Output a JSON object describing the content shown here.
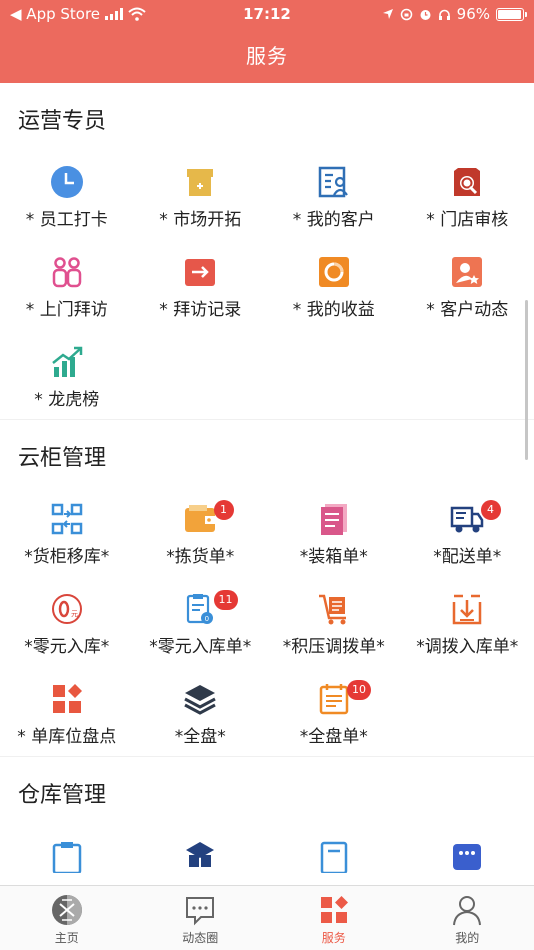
{
  "status_bar": {
    "back_app": "◀ App Store",
    "time": "17:12",
    "battery": "96%",
    "battery_level": 0.96
  },
  "header": {
    "title": "服务"
  },
  "sections": [
    {
      "title": "运营专员",
      "items": [
        {
          "label": "* 员工打卡",
          "icon": "clock-icon",
          "color": "#4a90e2"
        },
        {
          "label": "* 市场开拓",
          "icon": "shop-icon",
          "color": "#e6b84a"
        },
        {
          "label": "* 我的客户",
          "icon": "customer-card-icon",
          "color": "#2f6fb5"
        },
        {
          "label": "* 门店审核",
          "icon": "store-search-icon",
          "color": "#c0392b"
        },
        {
          "label": "* 上门拜访",
          "icon": "visit-people-icon",
          "color": "#e0508f"
        },
        {
          "label": "* 拜访记录",
          "icon": "visit-record-icon",
          "color": "#e6574a"
        },
        {
          "label": "* 我的收益",
          "icon": "earnings-icon",
          "color": "#f08a24"
        },
        {
          "label": "* 客户动态",
          "icon": "customer-activity-icon",
          "color": "#ee7452"
        },
        {
          "label": "* 龙虎榜",
          "icon": "ranking-chart-icon",
          "color": "#2eaa8f"
        }
      ]
    },
    {
      "title": "云柜管理",
      "items": [
        {
          "label": "*货柜移库*",
          "icon": "container-transfer-icon",
          "color": "#3a8fd8"
        },
        {
          "label": "*拣货单*",
          "icon": "picking-wallet-icon",
          "color": "#f2a33a",
          "badge": "1"
        },
        {
          "label": "*装箱单*",
          "icon": "packing-list-icon",
          "color": "#d9578a"
        },
        {
          "label": "*配送单*",
          "icon": "delivery-truck-icon",
          "color": "#23417f",
          "badge": "4"
        },
        {
          "label": "*零元入库*",
          "icon": "zero-yuan-icon",
          "color": "#d9463b"
        },
        {
          "label": "*零元入库单*",
          "icon": "zero-yuan-list-icon",
          "color": "#3a8fd8",
          "badge": "11"
        },
        {
          "label": "*积压调拨单*",
          "icon": "cart-transfer-icon",
          "color": "#e8692f"
        },
        {
          "label": "*调拨入库单*",
          "icon": "transfer-inbound-icon",
          "color": "#e8692f"
        },
        {
          "label": "* 单库位盘点",
          "icon": "slot-inventory-icon",
          "color": "#e8573f"
        },
        {
          "label": "*全盘*",
          "icon": "layers-icon",
          "color": "#2f3a4a"
        },
        {
          "label": "*全盘单*",
          "icon": "calendar-list-icon",
          "color": "#f08a24",
          "badge": "10"
        }
      ]
    },
    {
      "title": "仓库管理",
      "items": [
        {
          "label": "",
          "icon": "warehouse-clipboard-icon",
          "color": "#3a8fd8"
        },
        {
          "label": "",
          "icon": "warehouse-boxes-icon",
          "color": "#23417f"
        },
        {
          "label": "",
          "icon": "warehouse-doc-icon",
          "color": "#3a8fd8"
        },
        {
          "label": "",
          "icon": "warehouse-chat-icon",
          "color": "#3a5fcd"
        }
      ]
    }
  ],
  "tabbar": [
    {
      "label": "主页",
      "icon": "home-icon"
    },
    {
      "label": "动态圈",
      "icon": "chat-icon"
    },
    {
      "label": "服务",
      "icon": "service-grid-icon",
      "active": true
    },
    {
      "label": "我的",
      "icon": "profile-icon"
    }
  ],
  "colors": {
    "brand": "#ec6a5e",
    "tab_active": "#ec5a47",
    "badge": "#e53935"
  }
}
